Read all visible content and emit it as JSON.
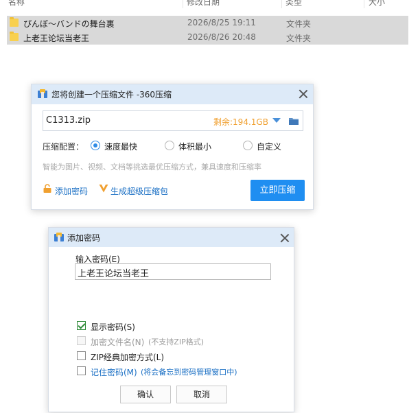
{
  "explorer": {
    "columns": [
      "名称",
      "修改日期",
      "类型",
      "大小"
    ],
    "rows": [
      {
        "name": "ぴんぼ～バンドの舞台裏",
        "date": "2026/8/25 19:11",
        "type": "文件夹"
      },
      {
        "name": "上老王论坛当老王",
        "date": "2026/8/26 20:48",
        "type": "文件夹"
      }
    ]
  },
  "compress_dialog": {
    "title": "您将创建一个压缩文件 -360压缩",
    "filename": "C1313.zip",
    "free_space": "剩余:194.1GB",
    "config_label": "压缩配置：",
    "options": [
      "速度最快",
      "体积最小",
      "自定义"
    ],
    "selected_option": "速度最快",
    "hint": "智能为图片、视频、文档等挑选最优压缩方式，兼具速度和压缩率",
    "add_password": "添加密码",
    "super_package": "生成超级压缩包",
    "compress_button": "立即压缩",
    "colors": {
      "accent": "#1f8ef1",
      "free_space": "#f0a030",
      "link": "#1a6fc4"
    }
  },
  "password_dialog": {
    "title": "添加密码",
    "input_label": "输入密码(E)",
    "password_value": "上老王论坛当老王",
    "show_password": {
      "label": "显示密码(S)",
      "checked": true
    },
    "encrypt_filenames": {
      "label": "加密文件名(N)",
      "note": "(不支持ZIP格式)",
      "enabled": false
    },
    "zip_classic": {
      "label": "ZIP经典加密方式(L)",
      "checked": false
    },
    "remember": {
      "label": "记住密码(M)",
      "note": "(将会备忘到密码管理窗口中)",
      "checked": false
    },
    "ok_button": "确认",
    "cancel_button": "取消"
  }
}
